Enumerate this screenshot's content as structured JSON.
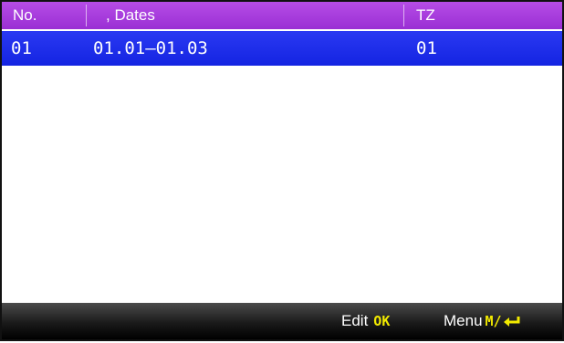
{
  "table": {
    "columns": {
      "no": "No.",
      "dates": ", Dates",
      "tz": "TZ"
    },
    "rows": [
      {
        "no": "01",
        "dates": "01.01—01.03",
        "tz": "01",
        "selected": true
      }
    ]
  },
  "footer": {
    "edit_label": "Edit",
    "edit_key": "OK",
    "menu_label": "Menu",
    "menu_key": "M/",
    "menu_key_icon": "enter-arrow-icon"
  },
  "colors": {
    "header_bg": "#a93ddd",
    "selected_row_bg": "#1f2fea",
    "footer_bg": "#1a1a1a",
    "key_color": "#f2ea00"
  }
}
